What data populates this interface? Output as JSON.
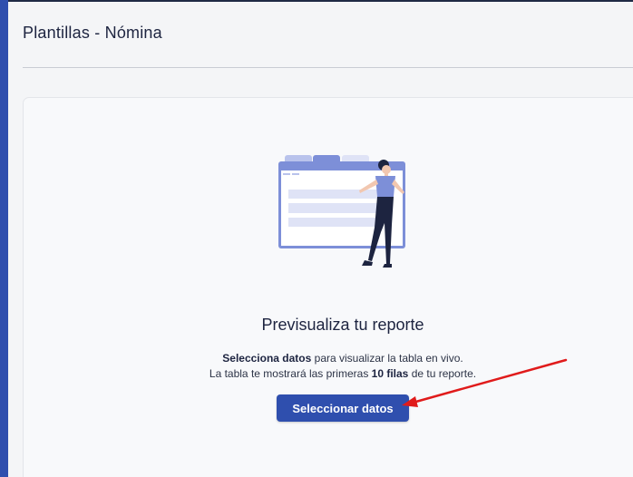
{
  "page": {
    "title": "Plantillas - Nómina"
  },
  "preview": {
    "heading": "Previsualiza tu reporte",
    "line1_bold": "Selecciona datos",
    "line1_rest": " para visualizar la tabla en vivo.",
    "line2_pre": "La tabla te mostrará las primeras ",
    "line2_bold": "10 filas",
    "line2_post": " de tu reporte.",
    "button_label": "Seleccionar datos"
  },
  "colors": {
    "accent": "#2f4fae",
    "annotation_arrow": "#e01b1b",
    "illustration_primary": "#7d8fd8",
    "illustration_light": "#dfe3f6",
    "figure_dark": "#1d2440"
  },
  "icons": {
    "illustration": "person-with-table-illustration",
    "annotation": "red-arrow-annotation"
  }
}
